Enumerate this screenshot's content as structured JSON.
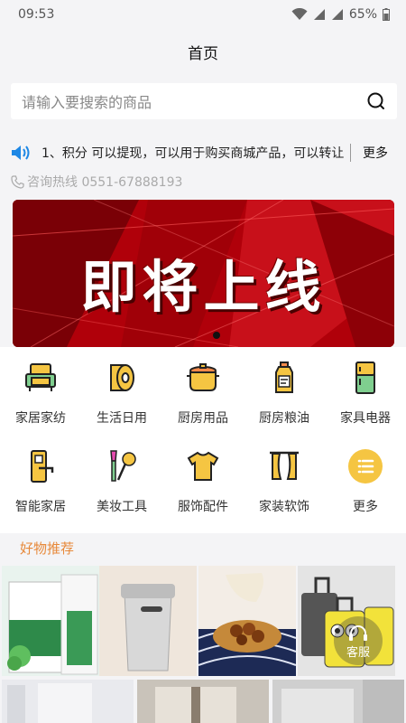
{
  "status_bar": {
    "time": "09:53",
    "battery": "65%"
  },
  "header": {
    "title": "首页"
  },
  "search": {
    "placeholder": "请输入要搜索的商品"
  },
  "notice": {
    "text": "1、积分 可以提现，可以用于购买商城产品，可以转让",
    "more": "更多"
  },
  "hotline": {
    "text": "咨询热线 0551-67888193"
  },
  "banner": {
    "text": "即将上线",
    "active_slide": 1,
    "slide_count": 1
  },
  "categories": [
    {
      "label": "家居家纺",
      "icon": "sofa-icon"
    },
    {
      "label": "生活日用",
      "icon": "tissue-roll-icon"
    },
    {
      "label": "厨房用品",
      "icon": "cooking-pot-icon"
    },
    {
      "label": "厨房粮油",
      "icon": "oil-bottle-icon"
    },
    {
      "label": "家具电器",
      "icon": "refrigerator-icon"
    },
    {
      "label": "智能家居",
      "icon": "smart-lock-icon"
    },
    {
      "label": "美妆工具",
      "icon": "makeup-brush-icon"
    },
    {
      "label": "服饰配件",
      "icon": "tshirt-icon"
    },
    {
      "label": "家装软饰",
      "icon": "curtain-icon"
    },
    {
      "label": "更多",
      "icon": "more-menu-icon"
    }
  ],
  "recommend": {
    "title": "好物推荐"
  },
  "customer_service": {
    "label": "客服"
  },
  "colors": {
    "accent": "#e7893a",
    "banner_red": "#b80008",
    "icon_yellow": "#f5c542"
  }
}
